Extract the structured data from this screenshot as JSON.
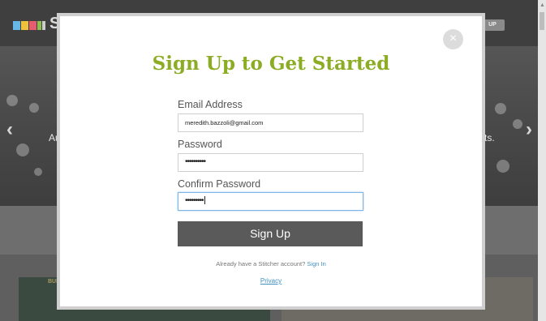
{
  "background": {
    "logo_text": "S",
    "header_signup_label": "UP",
    "hero_left_text": "Au",
    "hero_right_text": "ts.",
    "card_left_tag": "BUN",
    "logo_colors": [
      "#67b7e6",
      "#f0c23c",
      "#e65d70",
      "#8cc152",
      "#cccccc"
    ]
  },
  "modal": {
    "close_label": "×",
    "title": "Sign Up to Get Started",
    "email_label": "Email Address",
    "email_value": "meredith.bazzoli@gmail.com",
    "password_label": "Password",
    "password_value": "••••••••••",
    "confirm_label": "Confirm Password",
    "confirm_value": "•••••••••",
    "signup_button": "Sign Up",
    "already_text": "Already have a Stitcher account?",
    "signin_link": "Sign In",
    "privacy_link": "Privacy"
  },
  "colors": {
    "title_green": "#8cac24",
    "link_blue": "#3f8fbf",
    "button_gray": "#5a5a5a"
  }
}
